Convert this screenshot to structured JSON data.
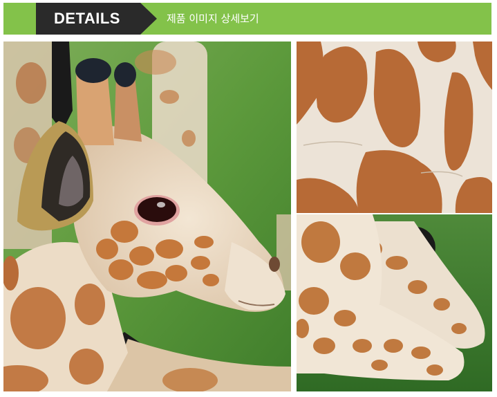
{
  "header": {
    "title": "DETAILS",
    "subtitle": "제품 이미지 상세보기",
    "bar_color": "#83c24a",
    "tag_color": "#2a2a2a"
  },
  "photos": [
    {
      "name": "giraffe-head-closeup"
    },
    {
      "name": "giraffe-spots-texture"
    },
    {
      "name": "giraffe-legs-on-grass"
    }
  ]
}
